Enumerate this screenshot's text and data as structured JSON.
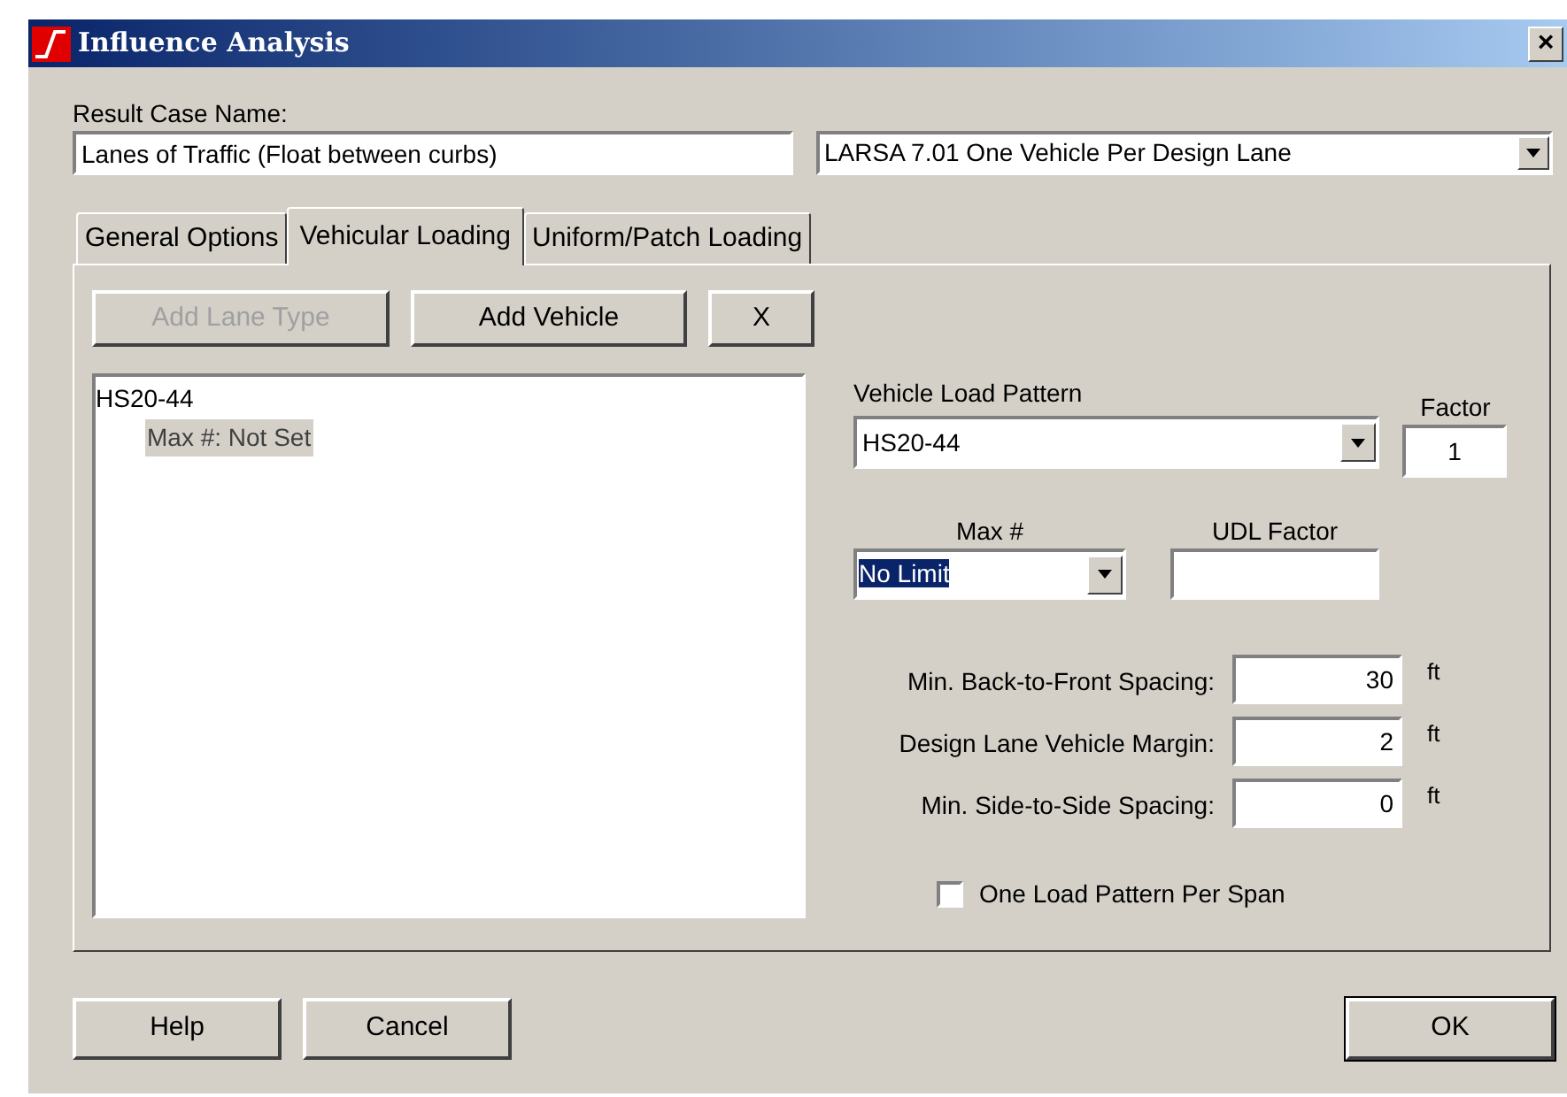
{
  "window": {
    "title": "Influence Analysis",
    "close": "×"
  },
  "result_case": {
    "label": "Result Case Name:",
    "value": "Lanes of Traffic (Float between curbs)"
  },
  "method_dropdown": {
    "value": "LARSA 7.01 One Vehicle Per Design Lane"
  },
  "tabs": [
    {
      "label": "General Options",
      "selected": false
    },
    {
      "label": "Vehicular Loading",
      "selected": true
    },
    {
      "label": "Uniform/Patch Loading",
      "selected": false
    }
  ],
  "toolbar": [
    {
      "label": "Add Lane Type",
      "disabled": true
    },
    {
      "label": "Add Vehicle",
      "disabled": false
    },
    {
      "label": "X",
      "disabled": false
    }
  ],
  "tree": [
    {
      "label": "HS20-44",
      "selected": false,
      "children": [
        {
          "label": "Max #: Not Set",
          "selected": true
        }
      ]
    }
  ],
  "vehicle_load_pattern": {
    "label": "Vehicle Load Pattern",
    "value": "HS20-44"
  },
  "factor": {
    "label": "Factor",
    "value": "1"
  },
  "max_count": {
    "label": "Max #",
    "value": "No Limit"
  },
  "udl_factor": {
    "label": "UDL Factor"
  },
  "spacing": [
    {
      "label": "Min. Back-to-Front Spacing:",
      "value": "30",
      "unit": "ft"
    },
    {
      "label": "Design Lane Vehicle Margin:",
      "value": "2",
      "unit": "ft"
    },
    {
      "label": "Min. Side-to-Side Spacing:",
      "value": "0",
      "unit": "ft"
    }
  ],
  "one_pattern_per_span": {
    "label": "One Load Pattern Per Span",
    "checked": false
  },
  "buttons": [
    {
      "label": "Help"
    },
    {
      "label": "Cancel"
    },
    {
      "label": "OK"
    }
  ]
}
